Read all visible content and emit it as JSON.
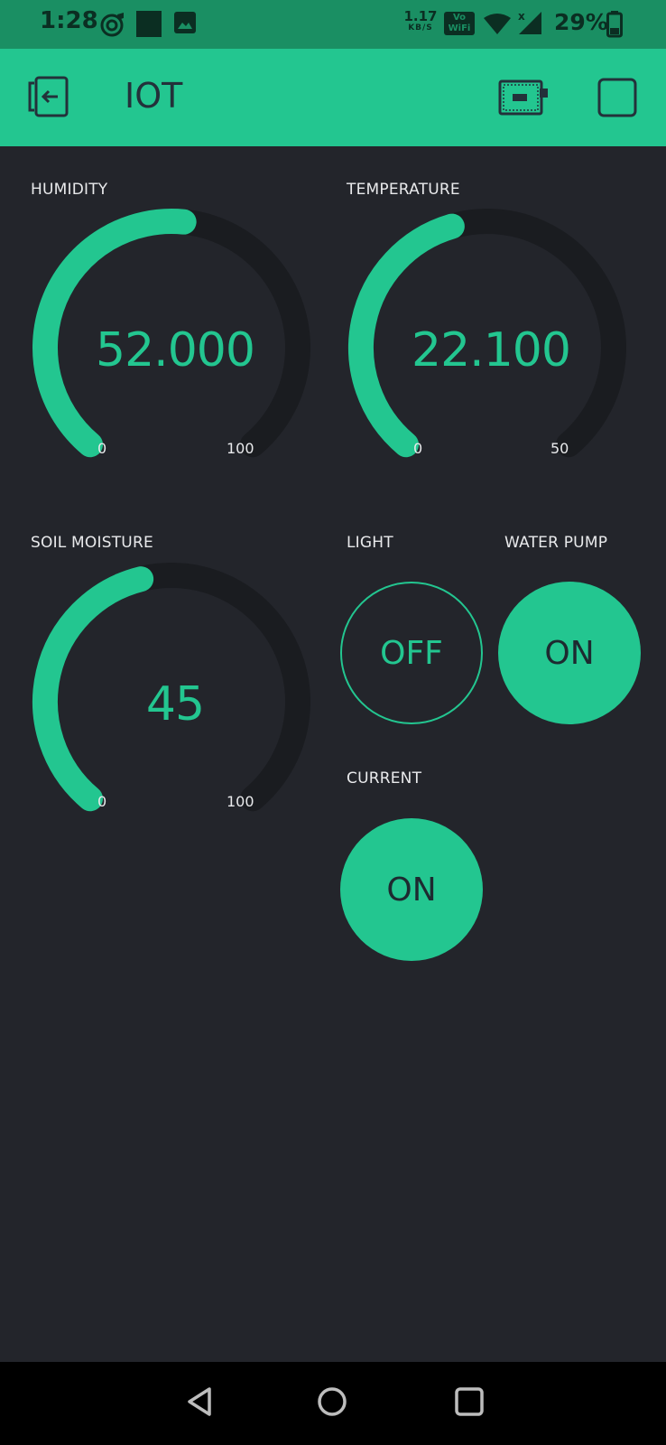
{
  "status_bar": {
    "time": "1:28",
    "net_speed": "1.17",
    "net_speed_unit": "KB/S",
    "vowifi_top": "Vo",
    "vowifi_bottom": "WiFi",
    "battery_percent": "29%",
    "icons": [
      "music-icon",
      "app-square-icon",
      "gallery-icon",
      "wifi-icon",
      "signal-icon",
      "battery-icon"
    ]
  },
  "header": {
    "title": "IOT",
    "icons": [
      "exit-icon",
      "device-board-icon",
      "stop-square-icon"
    ]
  },
  "widgets": {
    "humidity": {
      "label": "HUMIDITY",
      "value": "52.000",
      "min": "0",
      "max": "100",
      "fraction": 0.52
    },
    "temperature": {
      "label": "TEMPERATURE",
      "value": "22.100",
      "min": "0",
      "max": "50",
      "fraction": 0.442
    },
    "soil": {
      "label": "SOIL MOISTURE",
      "value": "45",
      "min": "0",
      "max": "100",
      "fraction": 0.45
    },
    "light": {
      "label": "LIGHT",
      "state": "OFF"
    },
    "water_pump": {
      "label": "WATER PUMP",
      "state": "ON"
    },
    "current": {
      "label": "CURRENT",
      "state": "ON"
    }
  },
  "colors": {
    "accent": "#23c690",
    "background": "#23252b",
    "track": "#1a1c20",
    "status_bar": "#1a8f63"
  },
  "nav": {
    "icons": [
      "back-icon",
      "home-icon",
      "recents-icon"
    ]
  }
}
